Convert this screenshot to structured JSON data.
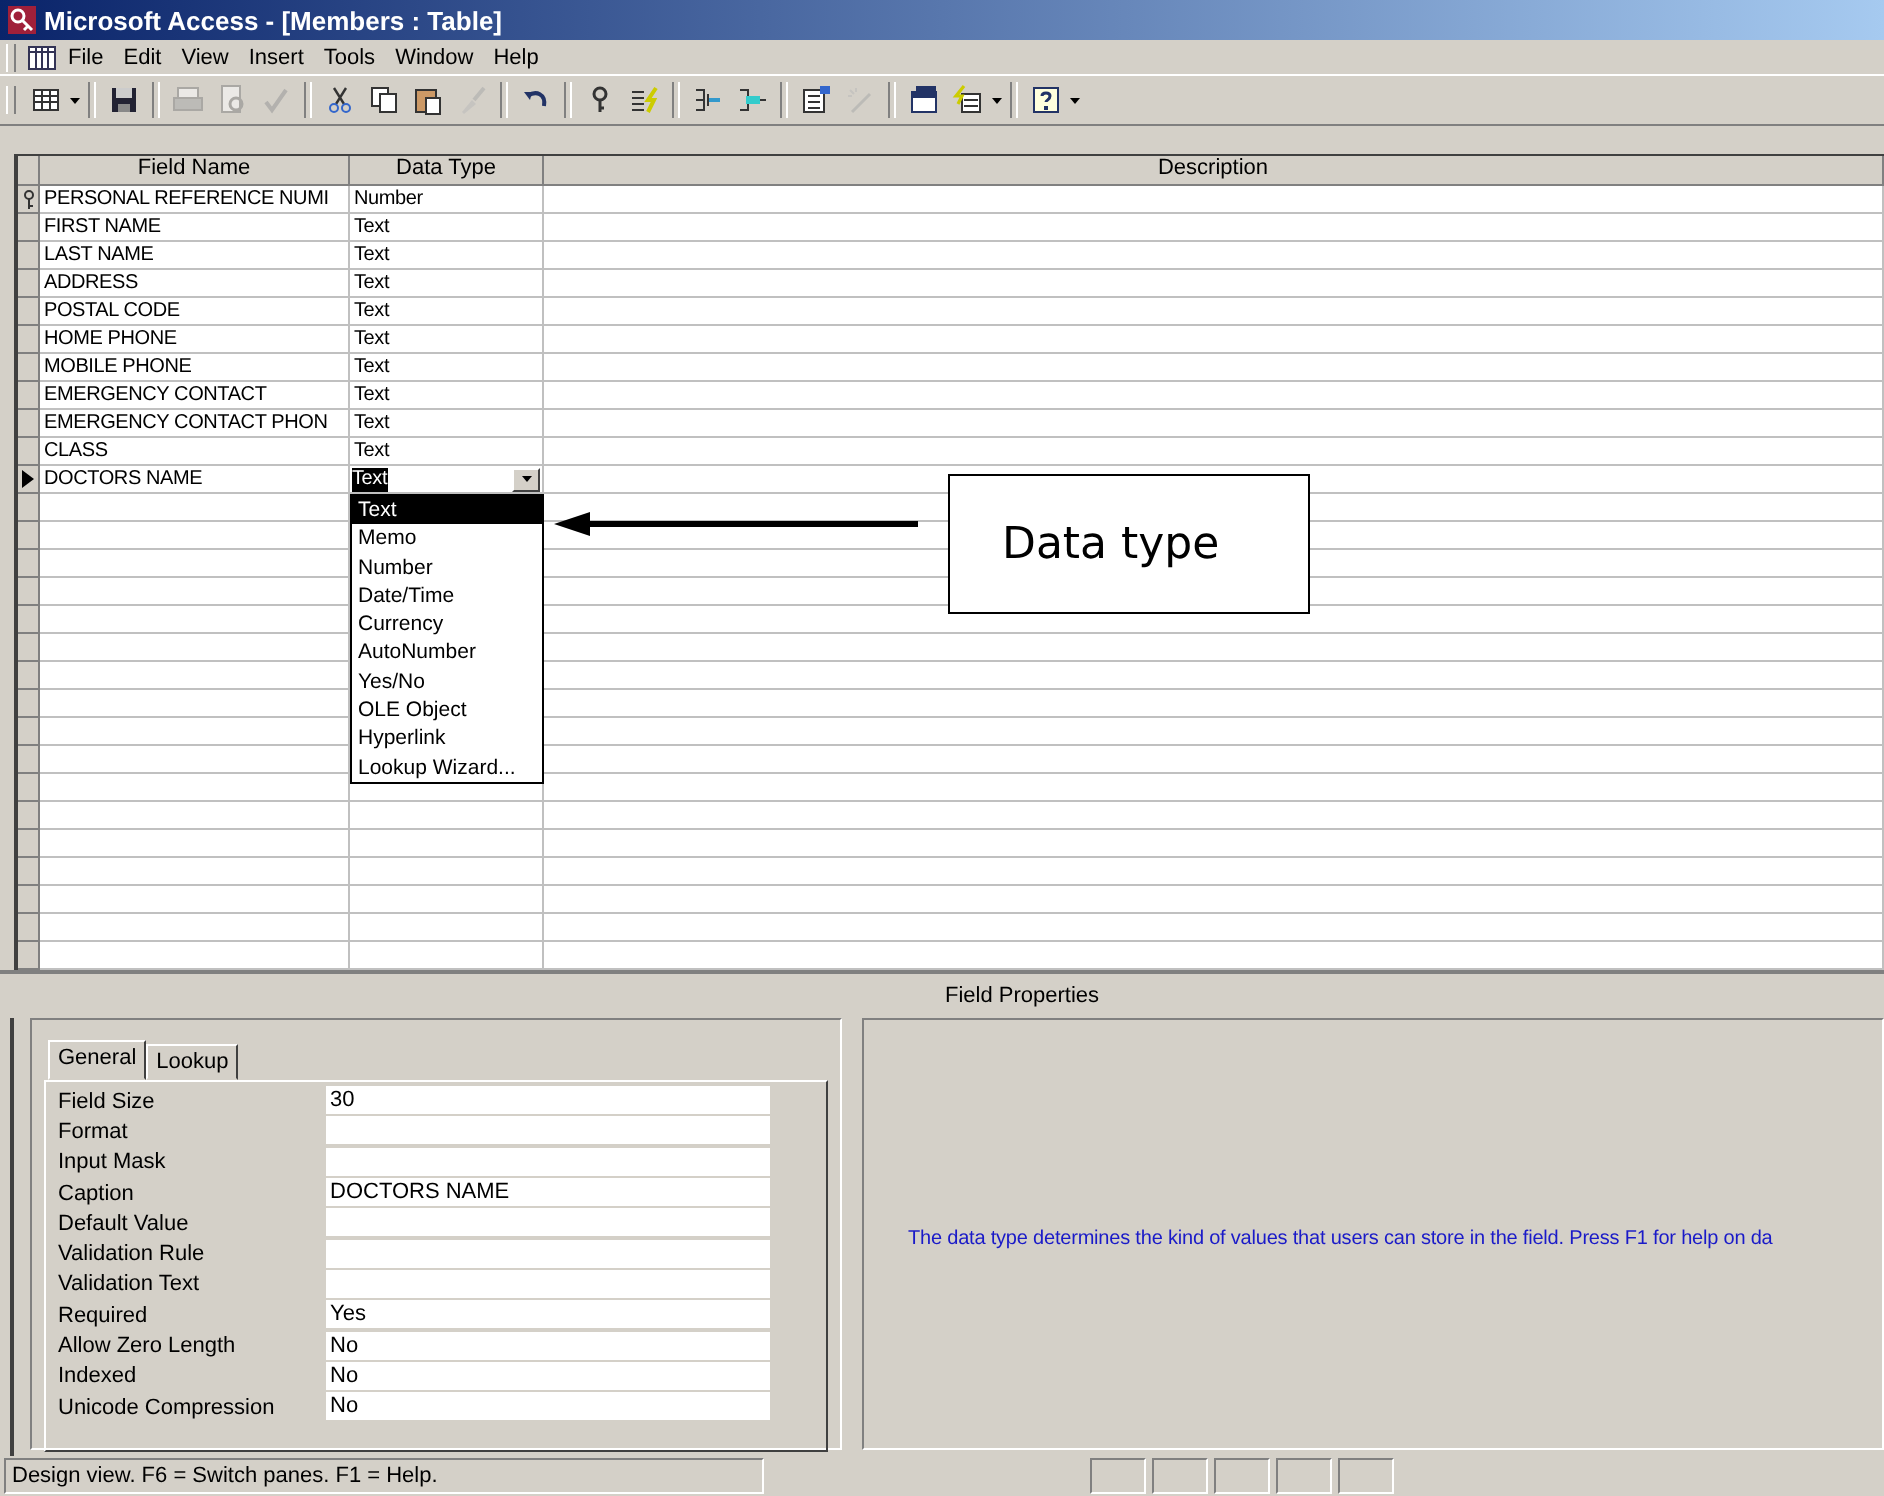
{
  "window": {
    "title": "Microsoft Access - [Members : Table]"
  },
  "menu": [
    {
      "label": "File"
    },
    {
      "label": "Edit"
    },
    {
      "label": "View"
    },
    {
      "label": "Insert"
    },
    {
      "label": "Tools"
    },
    {
      "label": "Window"
    },
    {
      "label": "Help"
    }
  ],
  "toolbar": [
    {
      "kind": "view",
      "disabled": false
    },
    {
      "kind": "caret",
      "disabled": false
    },
    {
      "kind": "separator"
    },
    {
      "kind": "save",
      "disabled": false
    },
    {
      "kind": "separator"
    },
    {
      "kind": "print",
      "disabled": true
    },
    {
      "kind": "preview",
      "disabled": true
    },
    {
      "kind": "spelling",
      "disabled": true
    },
    {
      "kind": "separator"
    },
    {
      "kind": "cut",
      "disabled": false
    },
    {
      "kind": "copy",
      "disabled": false
    },
    {
      "kind": "paste",
      "disabled": false
    },
    {
      "kind": "brush",
      "disabled": true
    },
    {
      "kind": "separator"
    },
    {
      "kind": "undo",
      "disabled": false
    },
    {
      "kind": "separator"
    },
    {
      "kind": "key",
      "disabled": false
    },
    {
      "kind": "indexes",
      "disabled": false
    },
    {
      "kind": "separator"
    },
    {
      "kind": "insert_rows",
      "disabled": false
    },
    {
      "kind": "delete_rows",
      "disabled": false
    },
    {
      "kind": "separator"
    },
    {
      "kind": "properties",
      "disabled": false
    },
    {
      "kind": "build",
      "disabled": true
    },
    {
      "kind": "separator"
    },
    {
      "kind": "database",
      "disabled": false
    },
    {
      "kind": "new_object",
      "disabled": false
    },
    {
      "kind": "caret",
      "disabled": false
    },
    {
      "kind": "separator"
    },
    {
      "kind": "help",
      "disabled": false
    },
    {
      "kind": "caret",
      "disabled": false
    }
  ],
  "grid": {
    "columns": [
      "Field Name",
      "Data Type",
      "Description"
    ],
    "rows": [
      {
        "field_name": "PERSONAL REFERENCE NUMI",
        "data_type": "Number",
        "primary_key": true,
        "current": false
      },
      {
        "field_name": "FIRST NAME",
        "data_type": "Text",
        "primary_key": false,
        "current": false
      },
      {
        "field_name": "LAST NAME",
        "data_type": "Text",
        "primary_key": false,
        "current": false
      },
      {
        "field_name": "ADDRESS",
        "data_type": "Text",
        "primary_key": false,
        "current": false
      },
      {
        "field_name": "POSTAL CODE",
        "data_type": "Text",
        "primary_key": false,
        "current": false
      },
      {
        "field_name": "HOME PHONE",
        "data_type": "Text",
        "primary_key": false,
        "current": false
      },
      {
        "field_name": "MOBILE PHONE",
        "data_type": "Text",
        "primary_key": false,
        "current": false
      },
      {
        "field_name": "EMERGENCY CONTACT",
        "data_type": "Text",
        "primary_key": false,
        "current": false
      },
      {
        "field_name": "EMERGENCY CONTACT PHON",
        "data_type": "Text",
        "primary_key": false,
        "current": false
      },
      {
        "field_name": "CLASS",
        "data_type": "Text",
        "primary_key": false,
        "current": false
      },
      {
        "field_name": "DOCTORS NAME",
        "data_type": "Text",
        "primary_key": false,
        "current": true
      }
    ]
  },
  "dropdown": {
    "options": [
      {
        "label": "Text",
        "selected": true
      },
      {
        "label": "Memo",
        "selected": false
      },
      {
        "label": "Number",
        "selected": false
      },
      {
        "label": "Date/Time",
        "selected": false
      },
      {
        "label": "Currency",
        "selected": false
      },
      {
        "label": "AutoNumber",
        "selected": false
      },
      {
        "label": "Yes/No",
        "selected": false
      },
      {
        "label": "OLE Object",
        "selected": false
      },
      {
        "label": "Hyperlink",
        "selected": false
      },
      {
        "label": "Lookup Wizard...",
        "selected": false
      }
    ]
  },
  "callout": {
    "text": "Data type"
  },
  "field_properties": {
    "title": "Field Properties",
    "tabs": [
      {
        "label": "General",
        "selected": true
      },
      {
        "label": "Lookup",
        "selected": false
      }
    ],
    "properties": [
      {
        "label": "Field Size",
        "value": "30"
      },
      {
        "label": "Format"
      },
      {
        "label": "Input Mask"
      },
      {
        "label": "Caption",
        "value": "DOCTORS NAME"
      },
      {
        "label": "Default Value"
      },
      {
        "label": "Validation Rule"
      },
      {
        "label": "Validation Text"
      },
      {
        "label": "Required",
        "value": "Yes"
      },
      {
        "label": "Allow Zero Length",
        "value": "No"
      },
      {
        "label": "Indexed",
        "value": "No"
      },
      {
        "label": "Unicode Compression",
        "value": "No"
      }
    ],
    "help_text": "The data type determines the kind of values that users can store in the field.  Press F1 for help on da"
  },
  "status_bar": {
    "text": "Design view.  F6 = Switch panes.  F1 = Help."
  }
}
